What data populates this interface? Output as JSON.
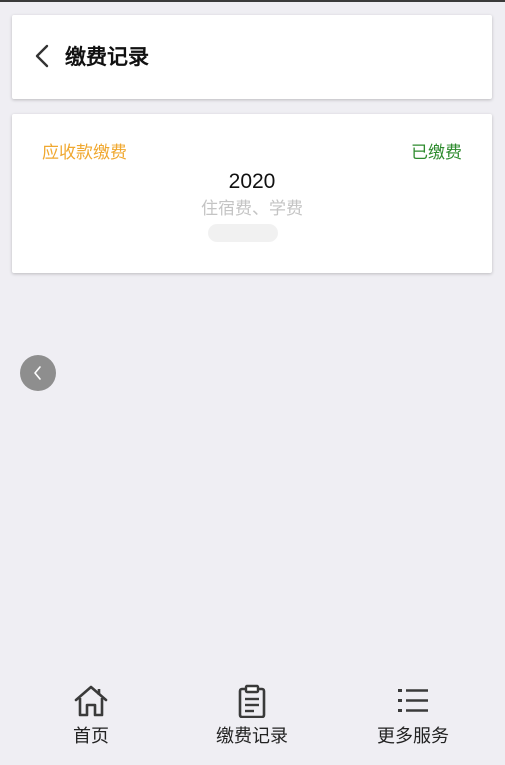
{
  "header": {
    "title": "缴费记录"
  },
  "record": {
    "fee_type": "应收款缴费",
    "status": "已缴费",
    "year": "2020",
    "items": "住宿费、学费"
  },
  "tabbar": {
    "tabs": [
      {
        "label": "首页",
        "icon": "home-icon"
      },
      {
        "label": "缴费记录",
        "icon": "clipboard-icon"
      },
      {
        "label": "更多服务",
        "icon": "list-icon"
      }
    ]
  },
  "colors": {
    "fee_type": "#f0a830",
    "status_paid": "#2e8b2e",
    "background": "#efeef3",
    "float_button": "#8e8e8e"
  }
}
